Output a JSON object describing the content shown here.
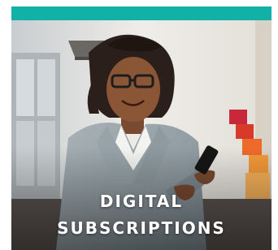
{
  "promo": {
    "title_line_1": "DIGITAL",
    "title_line_2": "SUBSCRIPTIONS"
  },
  "colors": {
    "accent_bar": "#12b1a8",
    "caption_text": "#ffffff"
  },
  "image": {
    "subject": "woman-with-smartphone-photo"
  }
}
